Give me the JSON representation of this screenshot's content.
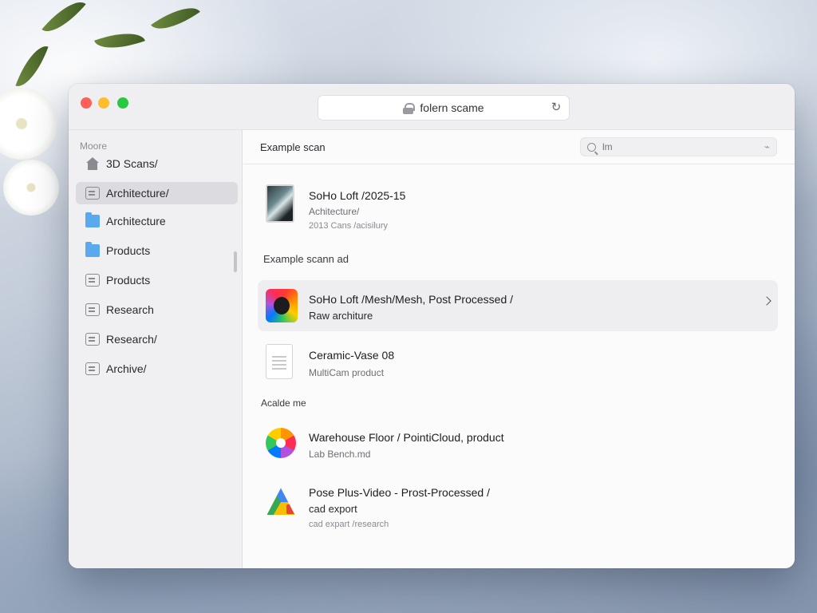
{
  "window": {
    "address": "folern scame"
  },
  "sidebar": {
    "heading": "Moore",
    "items": [
      {
        "label": "3D Scans/",
        "icon": "home-icon"
      },
      {
        "label": "Architecture/",
        "icon": "scan-icon",
        "active": true
      },
      {
        "label": "Architecture",
        "icon": "folder-icon"
      },
      {
        "label": "Products",
        "icon": "folder-icon"
      },
      {
        "label": "Products",
        "icon": "document-icon"
      },
      {
        "label": "Research",
        "icon": "document-icon"
      },
      {
        "label": "Research/",
        "icon": "document-icon"
      },
      {
        "label": "Archive/",
        "icon": "archive-icon"
      }
    ]
  },
  "content": {
    "title": "Example scan",
    "search_placeholder": "lm",
    "sections": [
      {
        "label": ""
      },
      {
        "label": "Example scann ad"
      },
      {
        "label": "Acalde me"
      }
    ],
    "items": [
      {
        "title": "SoHo Loft /2025-15",
        "subtitle": "Achitecture/",
        "detail": "2013 Cans /acisilury"
      },
      {
        "title": "SoHo Loft /Mesh/Mesh, Post Processed /",
        "subtitle": "Raw architure",
        "selected": true
      },
      {
        "title": "Ceramic-Vase 08",
        "subtitle": "MultiCam product"
      },
      {
        "title": "Warehouse Floor / PointiCloud, product",
        "subtitle": "Lab Bench.md"
      },
      {
        "title": "Pose Plus-Video - Prost-Processed /",
        "subtitle": "cad export",
        "detail": "cad expart /research"
      }
    ]
  }
}
